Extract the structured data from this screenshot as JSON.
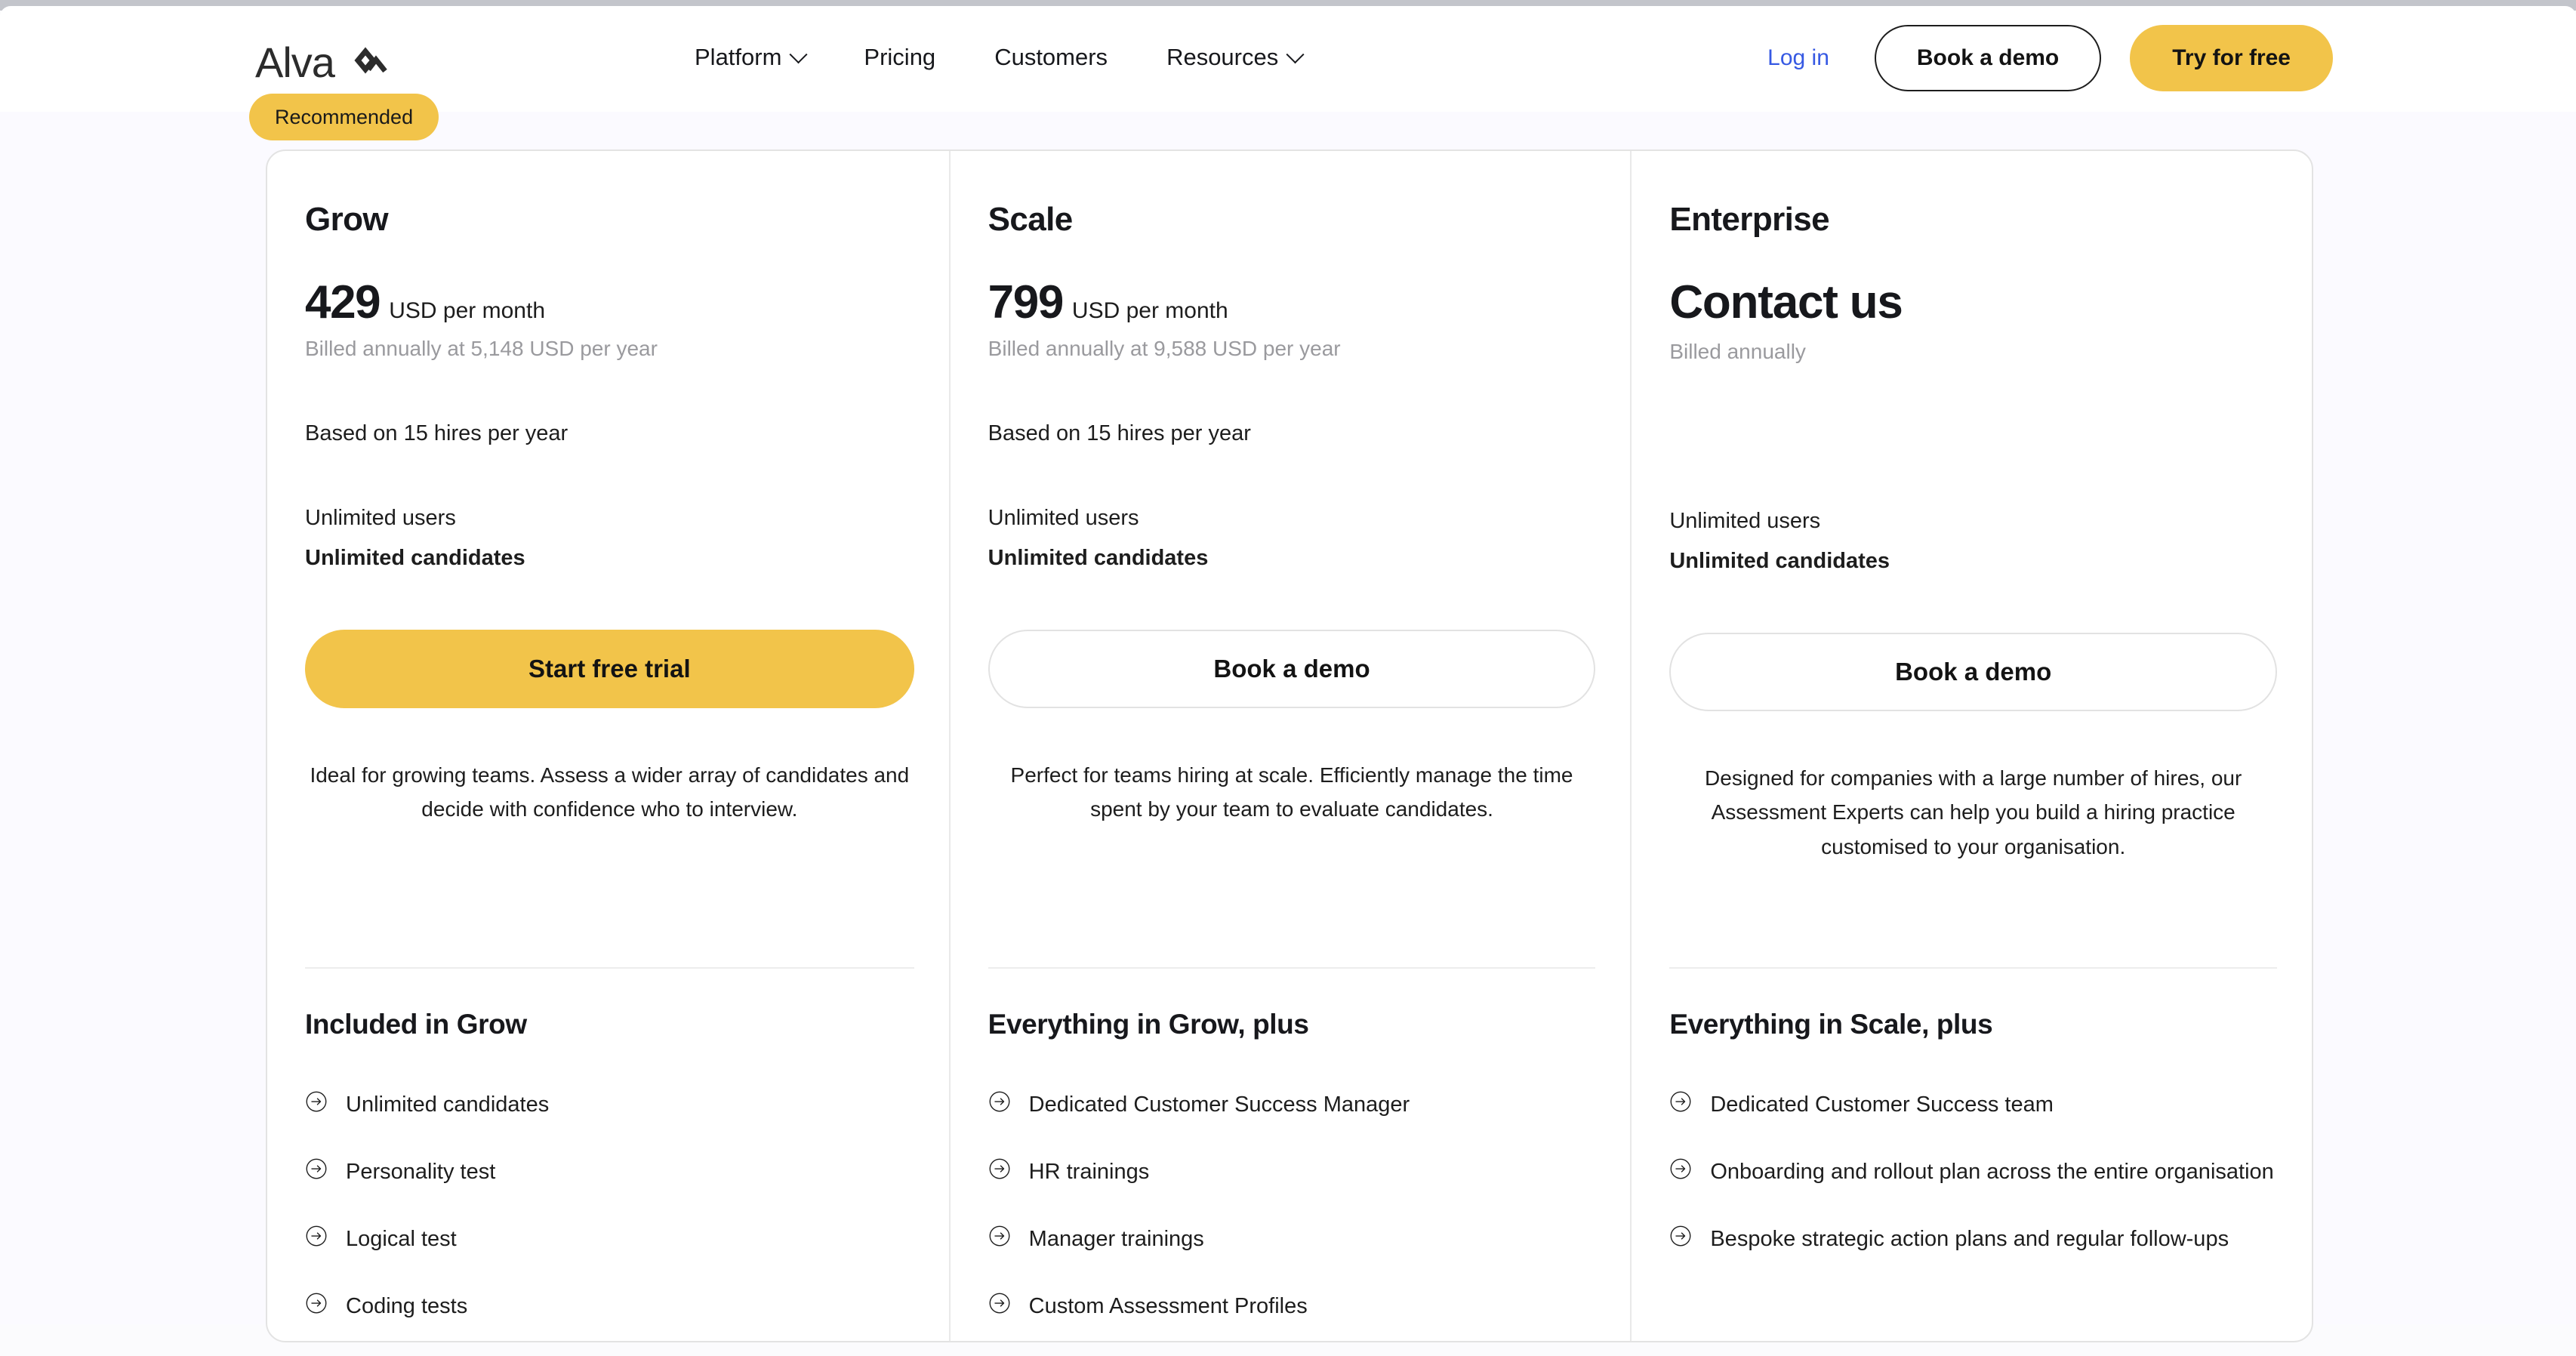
{
  "header": {
    "logo_text": "Alva",
    "logo_icon": "alva-diamond-logo",
    "nav": [
      {
        "label": "Platform",
        "has_dropdown": true
      },
      {
        "label": "Pricing",
        "has_dropdown": false
      },
      {
        "label": "Customers",
        "has_dropdown": false
      },
      {
        "label": "Resources",
        "has_dropdown": true
      }
    ],
    "login_label": "Log in",
    "book_demo_label": "Book a demo",
    "try_free_label": "Try for free",
    "login_color": "#3659e3",
    "accent_color": "#f2c44a"
  },
  "badge": {
    "label": "Recommended"
  },
  "plans": [
    {
      "name": "Grow",
      "price_amount": "429",
      "price_unit": "USD per month",
      "price_contact": "",
      "billed_note": "Billed annually at 5,148 USD per year",
      "hires_note": "Based on 15 hires per year",
      "spec_users": "Unlimited users",
      "spec_candidates": "Unlimited candidates",
      "cta_label": "Start free trial",
      "cta_style": "primary",
      "description": "Ideal for growing teams. Assess a wider array of candidates and decide with confidence who to interview.",
      "features_title": "Included in Grow",
      "features": [
        "Unlimited candidates",
        "Personality test",
        "Logical test",
        "Coding tests"
      ]
    },
    {
      "name": "Scale",
      "price_amount": "799",
      "price_unit": "USD per month",
      "price_contact": "",
      "billed_note": "Billed annually at 9,588 USD per year",
      "hires_note": "Based on 15 hires per year",
      "spec_users": "Unlimited users",
      "spec_candidates": "Unlimited candidates",
      "cta_label": "Book a demo",
      "cta_style": "ghost",
      "description": "Perfect for teams hiring at scale. Efficiently manage the time spent by your team to evaluate candidates.",
      "features_title": "Everything in Grow, plus",
      "features": [
        "Dedicated Customer Success Manager",
        "HR trainings",
        "Manager trainings",
        "Custom Assessment Profiles"
      ]
    },
    {
      "name": "Enterprise",
      "price_amount": "",
      "price_unit": "",
      "price_contact": "Contact us",
      "billed_note": "Billed annually",
      "hires_note": "",
      "spec_users": "Unlimited users",
      "spec_candidates": "Unlimited candidates",
      "cta_label": "Book a demo",
      "cta_style": "ghost",
      "description": "Designed for companies with a large number of hires, our Assessment Experts can help you build a hiring practice customised to your organisation.",
      "features_title": "Everything in Scale, plus",
      "features": [
        "Dedicated Customer Success team",
        "Onboarding and rollout plan across the entire organisation",
        "Bespoke strategic action plans and regular follow-ups"
      ]
    }
  ],
  "icons": {
    "feature_bullet": "circle-arrow-right-icon"
  }
}
